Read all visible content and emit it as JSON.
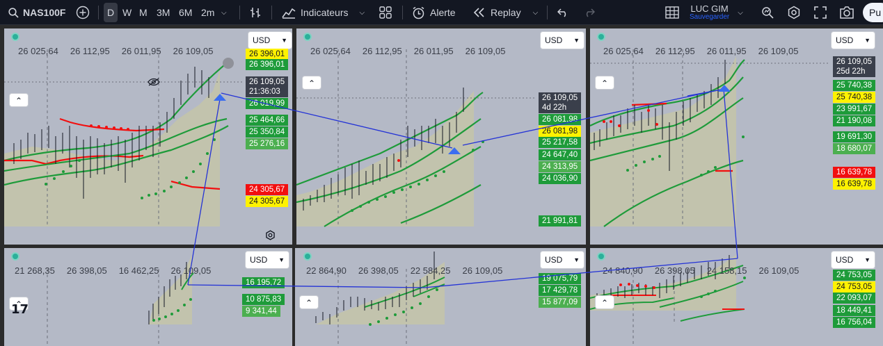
{
  "toolbar": {
    "symbol": "NAS100F",
    "timeframes": [
      "D",
      "W",
      "M",
      "3M",
      "6M",
      "2m"
    ],
    "active_timeframe": "D",
    "indicators_label": "Indicateurs",
    "alert_label": "Alerte",
    "replay_label": "Replay",
    "user_name": "LUC GIM",
    "save_label": "Sauvegarder",
    "publish_label": "Pu",
    "icons": [
      "search-icon",
      "add-icon",
      "bar-style-icon",
      "indicators-icon",
      "layout-icon",
      "alert-icon",
      "replay-icon",
      "undo-icon",
      "redo-icon",
      "grid-icon",
      "quick-search-icon",
      "settings-icon",
      "fullscreen-icon",
      "camera-icon"
    ]
  },
  "colors": {
    "toolbar_bg": "#131722",
    "pane_bg": "#b4b9c6",
    "green": "#1e9b3a",
    "red": "#f20f0f",
    "yellow": "#fff200",
    "trend_line": "#2433d6"
  },
  "panes": [
    {
      "currency": "USD",
      "top_labels": [
        "26 025,64",
        "26 112,95",
        "26 011,95",
        "26 109,05"
      ],
      "price_tags": [
        {
          "text": "26 396,01",
          "style": "yellow"
        },
        {
          "text": "26 396,01",
          "style": "green"
        },
        {
          "text": "26 109,05",
          "sub": "21:36:03",
          "style": "dark"
        },
        {
          "text": "26 019,99",
          "style": "green"
        },
        {
          "text": "25 464,66",
          "style": "green"
        },
        {
          "text": "25 350,84",
          "style": "green"
        },
        {
          "text": "25 276,16",
          "style": "lgreen"
        },
        {
          "text": "24 305,67",
          "style": "red"
        },
        {
          "text": "24 305,67",
          "style": "yellow"
        }
      ]
    },
    {
      "currency": "USD",
      "top_labels": [
        "26 025,64",
        "26 112,95",
        "26 011,95",
        "26 109,05"
      ],
      "price_tags": [
        {
          "text": "26 109,05",
          "sub": "4d 22h",
          "style": "dark"
        },
        {
          "text": "26 081,98",
          "style": "green"
        },
        {
          "text": "26 081,98",
          "style": "yellow"
        },
        {
          "text": "25 217,58",
          "style": "green"
        },
        {
          "text": "24 647,40",
          "style": "green"
        },
        {
          "text": "24 313,95",
          "style": "lgreen"
        },
        {
          "text": "24 036,90",
          "style": "green"
        },
        {
          "text": "21 991,81",
          "style": "green"
        }
      ]
    },
    {
      "currency": "USD",
      "top_labels": [
        "26 025,64",
        "26 112,95",
        "26 011,95",
        "26 109,05"
      ],
      "price_tags": [
        {
          "text": "26 109,05",
          "sub": "25d 22h",
          "style": "dark"
        },
        {
          "text": "25 740,38",
          "style": "green"
        },
        {
          "text": "25 740,38",
          "style": "yellow"
        },
        {
          "text": "23 991,67",
          "style": "green"
        },
        {
          "text": "21 190,08",
          "style": "green"
        },
        {
          "text": "19 691,30",
          "style": "green"
        },
        {
          "text": "18 680,07",
          "style": "lgreen"
        },
        {
          "text": "16 639,78",
          "style": "red"
        },
        {
          "text": "16 639,78",
          "style": "yellow"
        }
      ]
    },
    {
      "currency": "USD",
      "top_labels": [
        "21 268,35",
        "26 398,05",
        "16 462,25",
        "26 109,05"
      ],
      "price_tags": [
        {
          "text": "16 195,72",
          "style": "green"
        },
        {
          "text": "10 875,83",
          "style": "green"
        },
        {
          "text": "9 341,44",
          "style": "lgreen"
        }
      ]
    },
    {
      "currency": "USD",
      "top_labels": [
        "22 864,90",
        "26 398,05",
        "22 584,25",
        "26 109,05"
      ],
      "price_tags": [
        {
          "text": "19 075,79",
          "style": "green"
        },
        {
          "text": "17 429,78",
          "style": "green"
        },
        {
          "text": "15 877,09",
          "style": "lgreen"
        }
      ]
    },
    {
      "currency": "USD",
      "top_labels": [
        "24 840,90",
        "26 398,05",
        "24 158,15",
        "26 109,05"
      ],
      "price_tags": [
        {
          "text": "24 753,05",
          "style": "green"
        },
        {
          "text": "24 753,05",
          "style": "yellow"
        },
        {
          "text": "22 093,07",
          "style": "green"
        },
        {
          "text": "18 449,41",
          "style": "green"
        },
        {
          "text": "16 756,04",
          "style": "green"
        }
      ]
    }
  ]
}
